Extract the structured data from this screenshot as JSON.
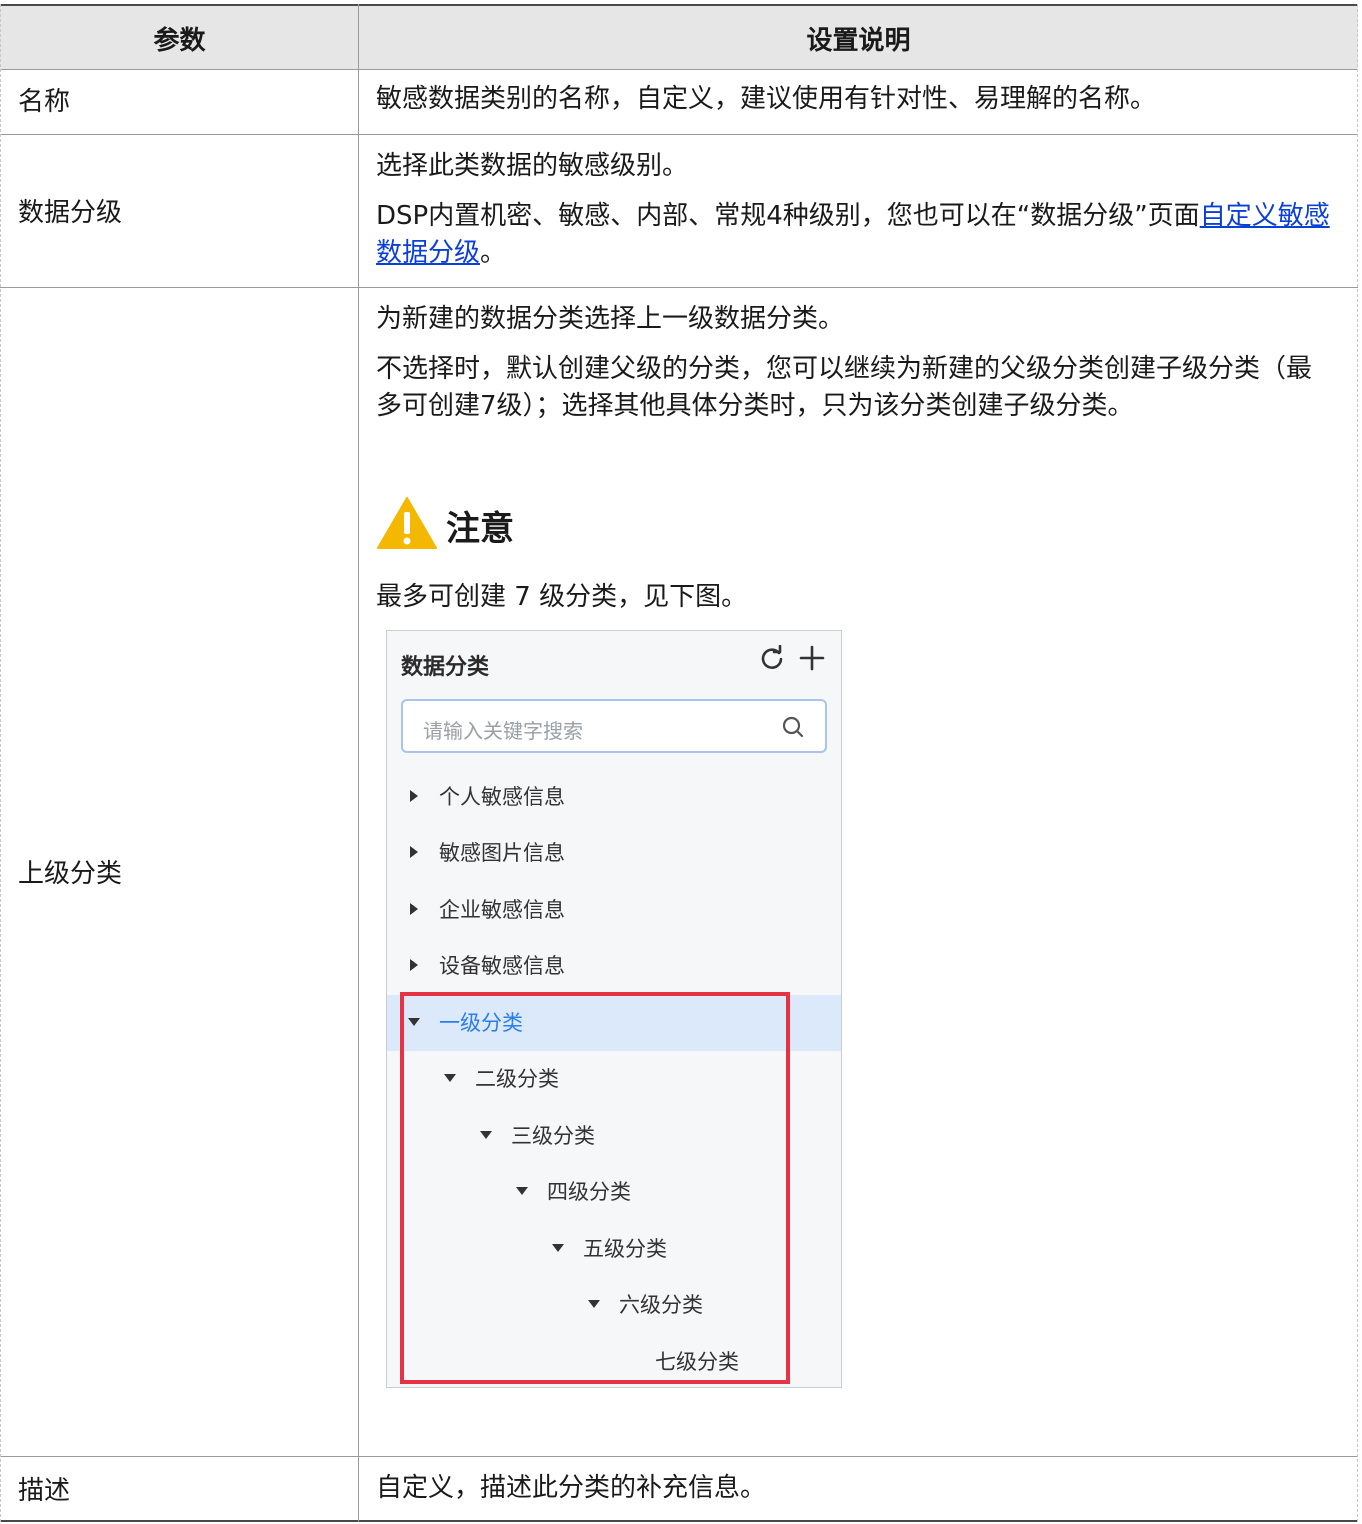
{
  "header": {
    "col1": "参数",
    "col2": "设置说明"
  },
  "rows": [
    {
      "param": "名称",
      "desc": "敏感数据类别的名称，自定义，建议使用有针对性、易理解的名称。"
    },
    {
      "param": "数据分级",
      "desc_line1": "选择此类数据的敏感级别。",
      "desc_line2_pre": "DSP内置机密、敏感、内部、常规4种级别，您也可以在“数据分级”页面",
      "desc_line2_link": "自定义敏感数据分级",
      "desc_line2_post": "。"
    },
    {
      "param": "上级分类",
      "desc_line1": "为新建的数据分类选择上一级数据分类。",
      "desc_line2": "不选择时，默认创建父级的分类，您可以继续为新建的父级分类创建子级分类（最多可创建7级）；选择其他具体分类时，只为该分类创建子级分类。",
      "note_title": "注意",
      "note_text": "最多可创建 7 级分类，见下图。"
    },
    {
      "param": "描述",
      "desc": "自定义，描述此分类的补充信息。"
    }
  ],
  "panel": {
    "title": "数据分类",
    "search_placeholder": "请输入关键字搜索",
    "items": [
      {
        "label": "个人敏感信息"
      },
      {
        "label": "敏感图片信息"
      },
      {
        "label": "企业敏感信息"
      },
      {
        "label": "设备敏感信息"
      },
      {
        "label": "一级分类"
      },
      {
        "label": "二级分类"
      },
      {
        "label": "三级分类"
      },
      {
        "label": "四级分类"
      },
      {
        "label": "五级分类"
      },
      {
        "label": "六级分类"
      },
      {
        "label": "七级分类"
      }
    ]
  },
  "colors": {
    "link": "#0b40d8",
    "highlight_border": "#e53343",
    "selected_bg": "#dbe9fb",
    "selected_text": "#2b7de9",
    "warning": "#f5b800"
  }
}
